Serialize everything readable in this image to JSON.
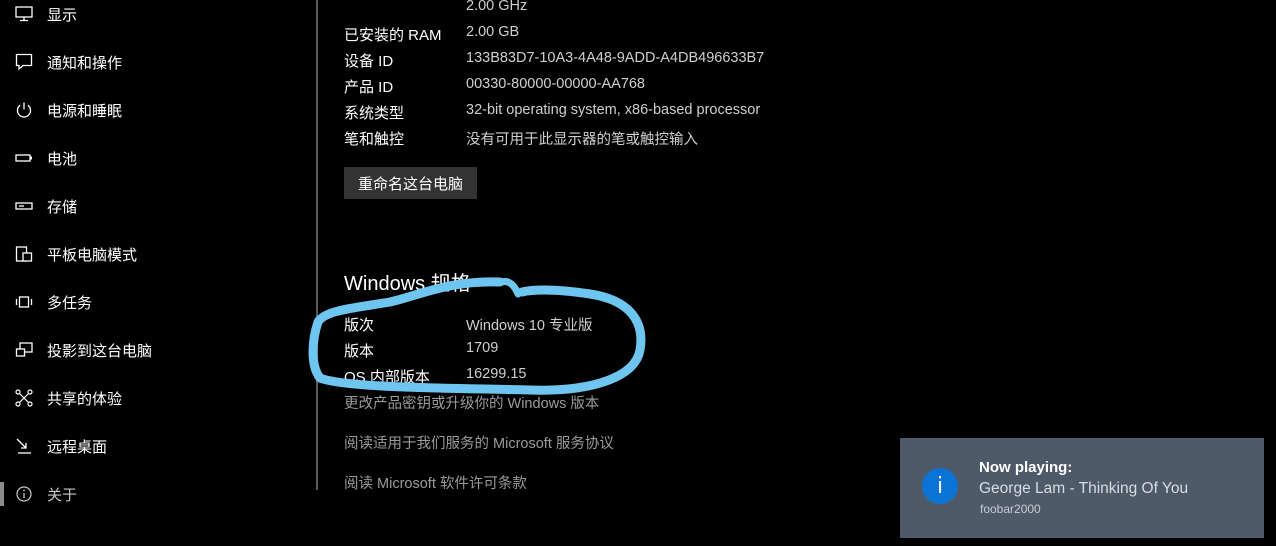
{
  "sidebar": {
    "items": [
      {
        "label": "显示",
        "icon": "monitor-icon"
      },
      {
        "label": "通知和操作",
        "icon": "notification-icon"
      },
      {
        "label": "电源和睡眠",
        "icon": "power-icon"
      },
      {
        "label": "电池",
        "icon": "battery-icon"
      },
      {
        "label": "存储",
        "icon": "storage-icon"
      },
      {
        "label": "平板电脑模式",
        "icon": "tablet-mode-icon"
      },
      {
        "label": "多任务",
        "icon": "multitasking-icon"
      },
      {
        "label": "投影到这台电脑",
        "icon": "project-icon"
      },
      {
        "label": "共享的体验",
        "icon": "shared-experience-icon"
      },
      {
        "label": "远程桌面",
        "icon": "remote-desktop-icon"
      },
      {
        "label": "关于",
        "icon": "info-icon",
        "selected": true
      }
    ]
  },
  "device_specs": {
    "processor_value": "2.00 GHz",
    "rows": [
      {
        "label": "已安装的 RAM",
        "value": "2.00 GB"
      },
      {
        "label": "设备 ID",
        "value": "133B83D7-10A3-4A48-9ADD-A4DB496633B7"
      },
      {
        "label": "产品 ID",
        "value": "00330-80000-00000-AA768"
      },
      {
        "label": "系统类型",
        "value": "32-bit operating system, x86-based processor"
      },
      {
        "label": "笔和触控",
        "value": "没有可用于此显示器的笔或触控输入"
      }
    ],
    "rename_button": "重命名这台电脑"
  },
  "windows_specs": {
    "title": "Windows 规格",
    "rows": [
      {
        "label": "版次",
        "value": "Windows 10 专业版"
      },
      {
        "label": "版本",
        "value": "1709"
      },
      {
        "label": "OS 内部版本",
        "value": "16299.15"
      }
    ]
  },
  "links": [
    "更改产品密钥或升级你的 Windows 版本",
    "阅读适用于我们服务的 Microsoft 服务协议",
    "阅读 Microsoft 软件许可条款"
  ],
  "toast": {
    "title": "Now playing:",
    "body": "George Lam - Thinking Of You",
    "app": "foobar2000",
    "icon": "info-icon"
  },
  "colors": {
    "background": "#000000",
    "annotation": "#6ec6f0",
    "toast_background": "#4f5a69",
    "toast_icon": "#0a73d6"
  }
}
